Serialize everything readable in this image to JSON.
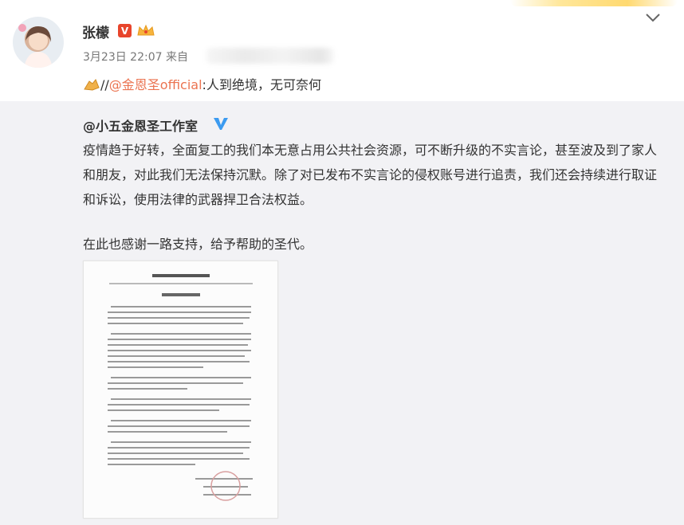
{
  "post": {
    "user_name": "张檬",
    "vip_badge": "V",
    "timestamp": "3月23日 22:07",
    "source_prefix": "来自",
    "repost_prefix": "//",
    "repost_mention": "@金恩圣official",
    "repost_text": ":人到绝境，无可奈何"
  },
  "retweet": {
    "author": "@小五金恩圣工作室",
    "paragraph": "疫情趋于好转，全面复工的我们本无意占用公共社会资源，可不断升级的不实言论，甚至波及到了家人和朋友，对此我们无法保持沉默。除了对已发布不实言论的侵权账号进行追责，我们还会持续进行取证和诉讼，使用法律的武器捍卫合法权益。",
    "thanks": "在此也感谢一路支持，给予帮助的圣代。"
  },
  "icons": {
    "more": "chevron-down-icon",
    "avatar": "avatar",
    "crown": "crown-icon",
    "clap": "clap-icon",
    "verified": "verified-v-icon"
  },
  "colors": {
    "link": "#eb7350",
    "badge_red": "#e8452c",
    "verified_blue": "#3c9bf0",
    "retweet_bg": "#f2f2f5"
  }
}
